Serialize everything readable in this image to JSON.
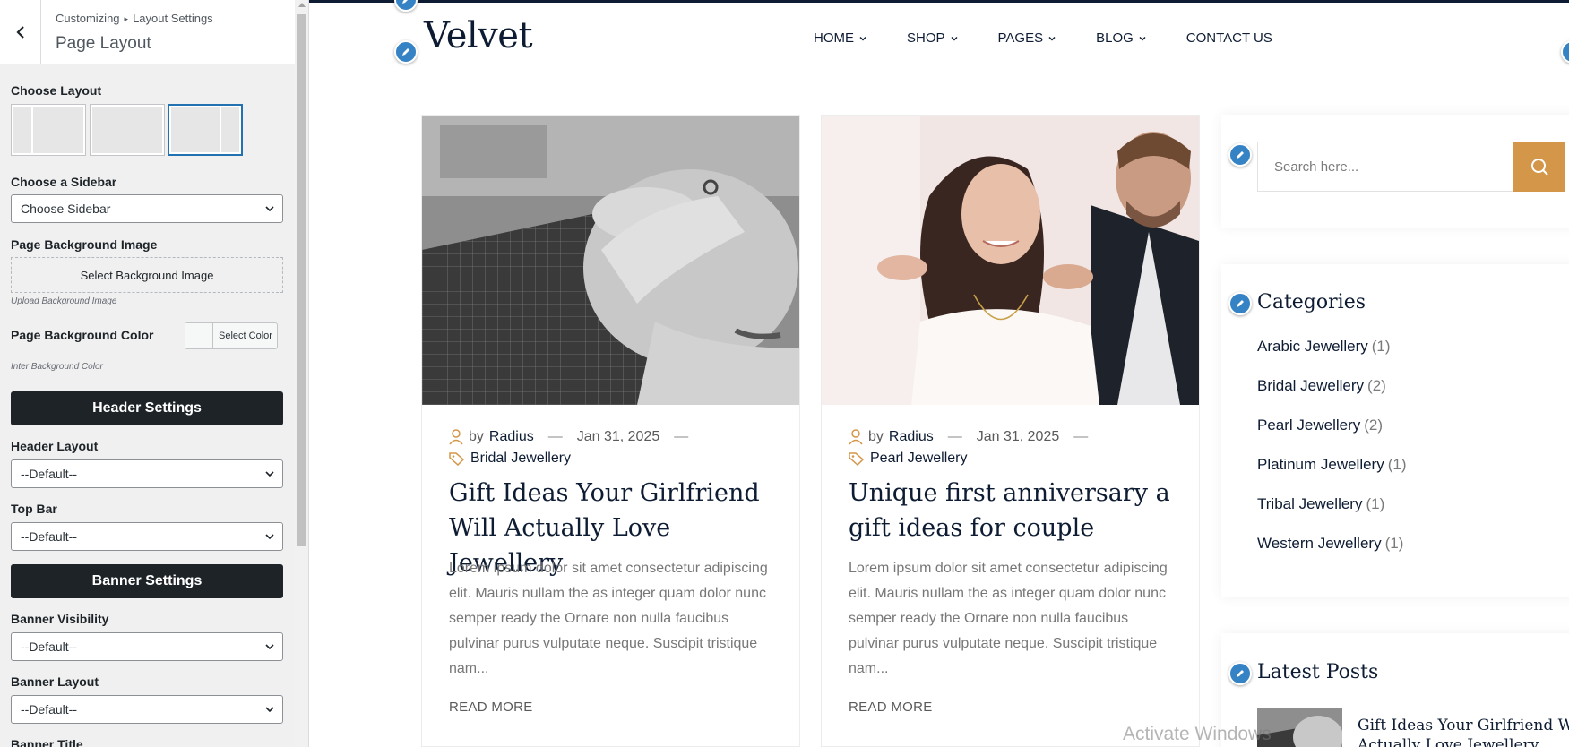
{
  "customizer": {
    "breadcrumb_root": "Customizing",
    "breadcrumb_sep": "▸",
    "breadcrumb_section": "Layout Settings",
    "title": "Page Layout",
    "choose_layout_label": "Choose Layout",
    "layouts": [
      "left-sidebar",
      "no-sidebar",
      "right-sidebar"
    ],
    "selected_layout": "right-sidebar",
    "choose_sidebar_label": "Choose a Sidebar",
    "choose_sidebar_value": "Choose Sidebar",
    "bg_image_label": "Page Background Image",
    "bg_image_button": "Select Background Image",
    "bg_image_hint": "Upload Background Image",
    "bg_color_label": "Page Background Color",
    "bg_color_button": "Select Color",
    "bg_color_hint": "Inter Background Color",
    "header_settings": "Header Settings",
    "header_layout_label": "Header Layout",
    "header_layout_value": "--Default--",
    "top_bar_label": "Top Bar",
    "top_bar_value": "--Default--",
    "banner_settings": "Banner Settings",
    "banner_visibility_label": "Banner Visibility",
    "banner_visibility_value": "--Default--",
    "banner_layout_label": "Banner Layout",
    "banner_layout_value": "--Default--",
    "banner_title_label": "Banner Title"
  },
  "site": {
    "logo": "Velvet",
    "nav": [
      {
        "label": "HOME",
        "dropdown": true
      },
      {
        "label": "SHOP",
        "dropdown": true
      },
      {
        "label": "PAGES",
        "dropdown": true
      },
      {
        "label": "BLOG",
        "dropdown": true
      },
      {
        "label": "CONTACT US",
        "dropdown": false
      }
    ],
    "posts": [
      {
        "by": "by",
        "author": "Radius",
        "dash": "—",
        "date": "Jan 31, 2025",
        "category": "Bridal Jewellery",
        "title": "Gift Ideas Your Girlfriend Will Actually Love Jewellery",
        "excerpt": "Lorem ipsum dolor sit amet consectetur adipiscing elit. Mauris nullam the as integer quam dolor nunc semper ready the Ornare non nulla faucibus pulvinar purus vulputate neque. Suscipit tristique nam...",
        "read_more": "READ MORE"
      },
      {
        "by": "by",
        "author": "Radius",
        "dash": "—",
        "date": "Jan 31, 2025",
        "category": "Pearl Jewellery",
        "title": "Unique first anniversary a gift ideas for couple",
        "excerpt": "Lorem ipsum dolor sit amet consectetur adipiscing elit. Mauris nullam the as integer quam dolor nunc semper ready the Ornare non nulla faucibus pulvinar purus vulputate neque. Suscipit tristique nam...",
        "read_more": "READ MORE"
      }
    ],
    "search_placeholder": "Search here...",
    "categories_title": "Categories",
    "categories": [
      {
        "name": "Arabic Jewellery",
        "count": "(1)"
      },
      {
        "name": "Bridal Jewellery",
        "count": "(2)"
      },
      {
        "name": "Pearl Jewellery",
        "count": "(2)"
      },
      {
        "name": "Platinum Jewellery",
        "count": "(1)"
      },
      {
        "name": "Tribal Jewellery",
        "count": "(1)"
      },
      {
        "name": "Western Jewellery",
        "count": "(1)"
      }
    ],
    "latest_posts_title": "Latest Posts",
    "latest_post_title": "Gift Ideas Your Girlfriend Will Actually Love Jewellery",
    "watermark": "Activate Windows"
  },
  "colors": {
    "accent": "#d4974a",
    "navy": "#0e1c33",
    "edit_blue": "#3582c4",
    "wp_dark": "#1d2327"
  },
  "icons": [
    "back-arrow-icon",
    "chevron-down-icon",
    "pencil-icon",
    "user-icon",
    "tag-icon",
    "search-icon"
  ]
}
